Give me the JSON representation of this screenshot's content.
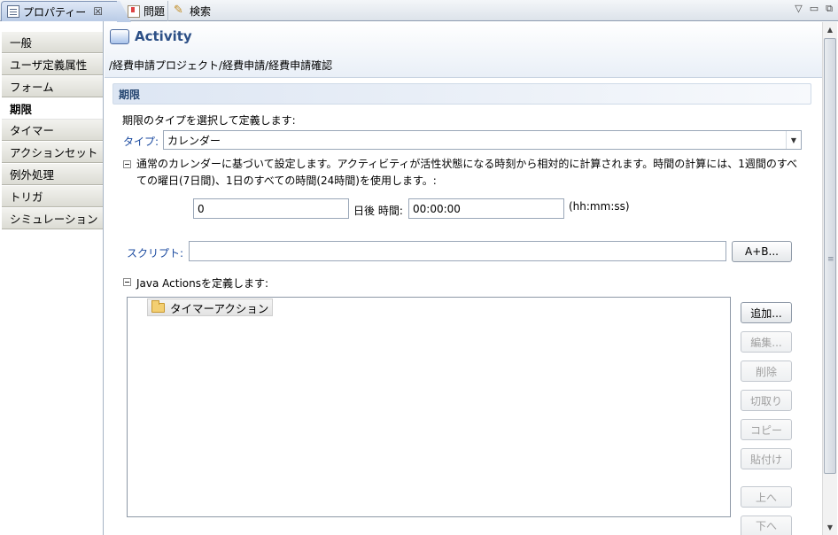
{
  "tabs": [
    {
      "label": "プロパティー",
      "icon": "properties-icon",
      "active": true
    },
    {
      "label": "問題",
      "icon": "problems-icon"
    },
    {
      "label": "検索",
      "icon": "search-icon"
    }
  ],
  "sidebar": {
    "items": [
      {
        "label": "一般"
      },
      {
        "label": "ユーザ定義属性"
      },
      {
        "label": "フォーム"
      },
      {
        "label": "期限",
        "active": true
      },
      {
        "label": "タイマー"
      },
      {
        "label": "アクションセット"
      },
      {
        "label": "例外処理"
      },
      {
        "label": "トリガ"
      },
      {
        "label": "シミュレーション"
      }
    ]
  },
  "header": {
    "title": "Activity",
    "path": "/経費申請プロジェクト/経費申請/経費申請確認"
  },
  "section": {
    "title": "期限",
    "intro": "期限のタイプを選択して定義します:",
    "type_label": "タイプ:",
    "type_value": "カレンダー",
    "description": "通常のカレンダーに基づいて設定します。アクティビティが活性状態になる時刻から相対的に計算されます。時間の計算には、1週間のすべての曜日(7日間)、1日のすべての時間(24時間)を使用します。:",
    "days_value": "0",
    "days_after_label": "日後 時間:",
    "time_value": "00:00:00",
    "time_format": "(hh:mm:ss)",
    "script_label": "スクリプト:",
    "script_value": "",
    "script_button": "A+B...",
    "java_actions_label": "Java Actionsを定義します:",
    "actions": [
      {
        "label": "タイマーアクション"
      }
    ],
    "buttons": {
      "add": "追加...",
      "edit": "編集...",
      "delete": "削除",
      "cut": "切取り",
      "copy": "コピー",
      "paste": "貼付け",
      "up": "上へ",
      "down": "下へ"
    }
  }
}
